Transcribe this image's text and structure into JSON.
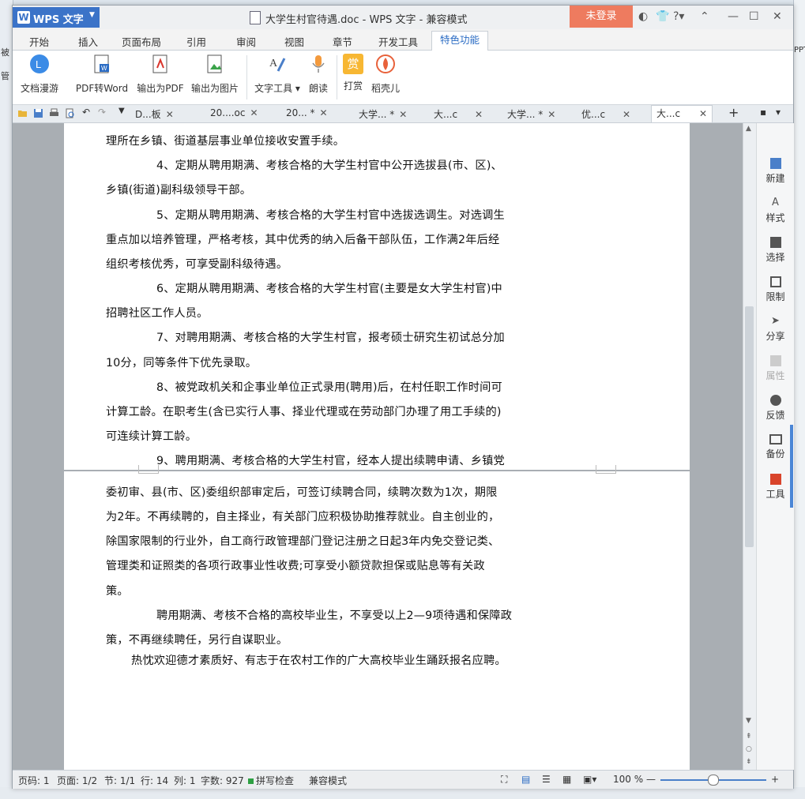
{
  "window": {
    "app_button": "WPS 文字",
    "title": "大学生村官待遇.doc - WPS 文字 - 兼容模式",
    "login": "未登录"
  },
  "desktop": {
    "left_a": "被",
    "left_b": "管",
    "right_a": "PPT"
  },
  "ribbon_tabs": [
    "开始",
    "插入",
    "页面布局",
    "引用",
    "审阅",
    "视图",
    "章节",
    "开发工具",
    "特色功能"
  ],
  "ribbon_buttons": [
    {
      "label": "文档漫游",
      "icon": "cloud-icon"
    },
    {
      "label": "PDF转Word",
      "icon": "pdf-to-word-icon"
    },
    {
      "label": "输出为PDF",
      "icon": "export-pdf-icon"
    },
    {
      "label": "输出为图片",
      "icon": "export-image-icon"
    },
    {
      "label": "文字工具 ▾",
      "icon": "text-tools-icon"
    },
    {
      "label": "朗读",
      "icon": "microphone-icon"
    },
    {
      "label": "打赏",
      "icon": "reward-icon"
    },
    {
      "label": "稻壳儿",
      "icon": "docer-icon"
    }
  ],
  "reward_glyph": "赏",
  "doc_tabs": [
    "D...板",
    "20....oc",
    "20... *",
    "大学... *",
    "大...c",
    "大学... *",
    "优...c",
    "大...c"
  ],
  "document_lines": [
    "理所在乡镇、街道基层事业单位接收安置手续。",
    "4、定期从聘用期满、考核合格的大学生村官中公开选拔县(市、区)、",
    "乡镇(街道)副科级领导干部。",
    "5、定期从聘用期满、考核合格的大学生村官中选拔选调生。对选调生",
    "重点加以培养管理，严格考核，其中优秀的纳入后备干部队伍，工作满2年后经",
    "组织考核优秀，可享受副科级待遇。",
    "6、定期从聘用期满、考核合格的大学生村官(主要是女大学生村官)中",
    "招聘社区工作人员。",
    "7、对聘用期满、考核合格的大学生村官，报考硕士研究生初试总分加",
    "10分，同等条件下优先录取。",
    "8、被党政机关和企事业单位正式录用(聘用)后，在村任职工作时间可",
    "计算工龄。在职考生(含已实行人事、择业代理或在劳动部门办理了用工手续的)",
    "可连续计算工龄。",
    "9、聘用期满、考核合格的大学生村官，经本人提出续聘申请、乡镇党",
    "委初审、县(市、区)委组织部审定后，可签订续聘合同，续聘次数为1次，期限",
    "为2年。不再续聘的，自主择业，有关部门应积极协助推荐就业。自主创业的，",
    "除国家限制的行业外，自工商行政管理部门登记注册之日起3年内免交登记类、",
    "管理类和证照类的各项行政事业性收费;可享受小额贷款担保或贴息等有关政",
    "策。",
    "聘用期满、考核不合格的高校毕业生，不享受以上2—9项待遇和保障政",
    "策，不再继续聘任，另行自谋职业。",
    "热忱欢迎德才素质好、有志于在农村工作的广大高校毕业生踊跃报名应聘。"
  ],
  "side_panel": [
    "新建",
    "样式",
    "选择",
    "限制",
    "分享",
    "属性",
    "反馈",
    "备份",
    "工具"
  ],
  "status": {
    "page_code": "页码: 1",
    "page": "页面: 1/2",
    "section": "节: 1/1",
    "row": "行: 14",
    "col": "列: 1",
    "words": "字数: 927",
    "spell": "拼写检查",
    "mode": "兼容模式",
    "zoom": "100 %"
  },
  "colors": {
    "accent": "#2b6cc4",
    "login": "#ee7b5f",
    "wps": "#3b73c8"
  }
}
